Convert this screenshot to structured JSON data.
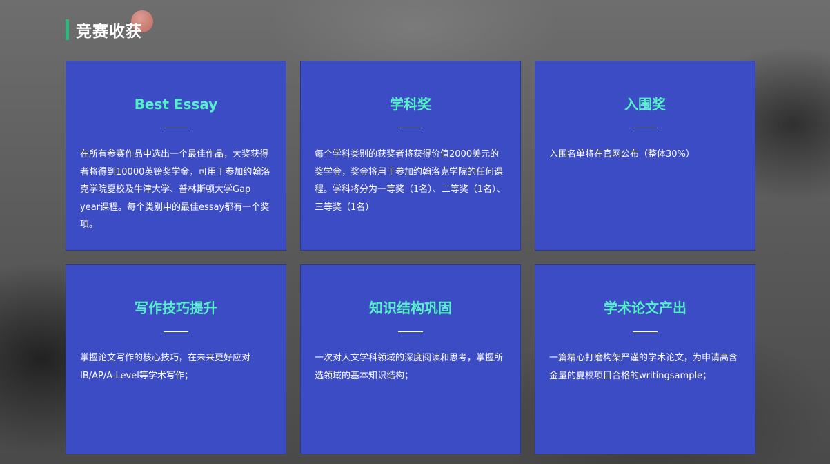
{
  "section": {
    "title": "竞赛收获",
    "accent_color": "#2fb67a"
  },
  "cards": [
    {
      "title": "Best Essay",
      "body": "在所有参赛作品中选出一个最佳作品，大奖获得者将得到10000英镑奖学金，可用于参加约翰洛克学院夏校及牛津大学、普林斯顿大学Gap year课程。每个类别中的最佳essay都有一个奖项。"
    },
    {
      "title": "学科奖",
      "body": "每个学科类别的获奖者将获得价值2000美元的奖学金，奖金将用于参加约翰洛克学院的任何课程。学科将分为一等奖（1名）、二等奖（1名）、三等奖（1名）"
    },
    {
      "title": "入围奖",
      "body": "入围名单将在官网公布（整体30%）"
    },
    {
      "title": "写作技巧提升",
      "body": "掌握论文写作的核心技巧，在未来更好应对IB/AP/A-Level等学术写作；"
    },
    {
      "title": "知识结构巩固",
      "body": "一次对人文学科领域的深度阅读和思考，掌握所选领域的基本知识结构；"
    },
    {
      "title": "学术论文产出",
      "body": "一篇精心打磨构架严谨的学术论文，为申请高含金量的夏校项目合格的writingsample；"
    }
  ],
  "colors": {
    "card_background": "#3c4cc4",
    "card_title": "#55f0c8",
    "body_text": "#ffffff"
  }
}
